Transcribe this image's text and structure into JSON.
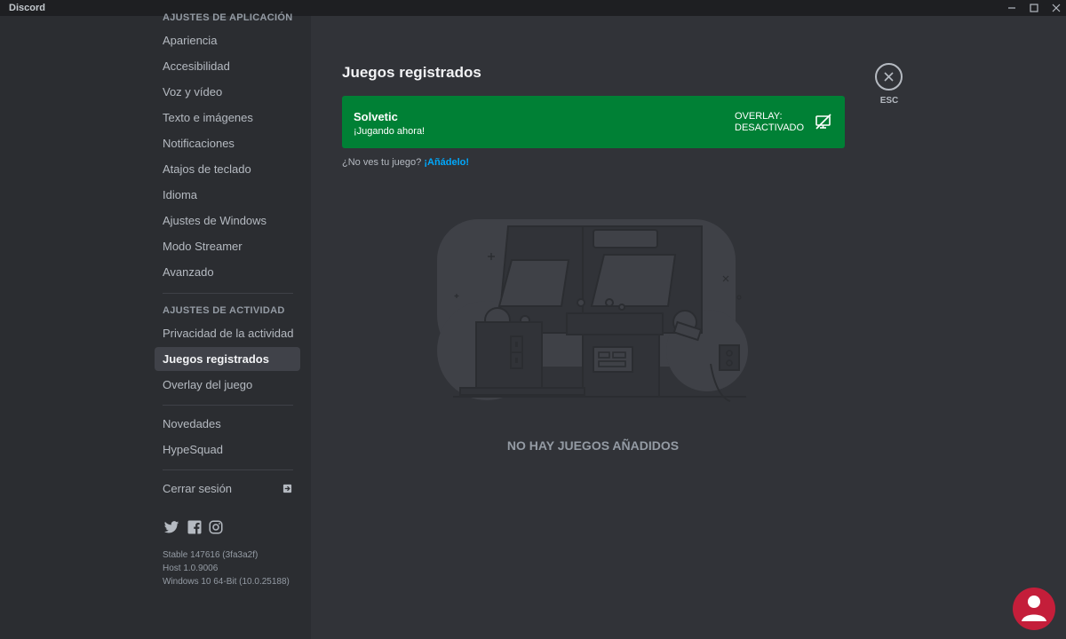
{
  "window": {
    "title": "Discord",
    "minimize": "—",
    "maximize": "☐",
    "close": "✕"
  },
  "sidebar": {
    "section_app": "AJUSTES DE APLICACIÓN",
    "app_items": [
      "Apariencia",
      "Accesibilidad",
      "Voz y vídeo",
      "Texto e imágenes",
      "Notificaciones",
      "Atajos de teclado",
      "Idioma",
      "Ajustes de Windows",
      "Modo Streamer",
      "Avanzado"
    ],
    "section_activity": "AJUSTES DE ACTIVIDAD",
    "activity_items": [
      "Privacidad de la actividad",
      "Juegos registrados",
      "Overlay del juego"
    ],
    "misc_items": [
      "Novedades",
      "HypeSquad"
    ],
    "logout": "Cerrar sesión",
    "socials": [
      "twitter-icon",
      "facebook-icon",
      "instagram-icon"
    ],
    "version_lines": [
      "Stable 147616 (3fa3a2f)",
      "Host 1.0.9006",
      "Windows 10 64-Bit (10.0.25188)"
    ]
  },
  "main": {
    "title": "Juegos registrados",
    "game": {
      "name": "Solvetic",
      "status": "¡Jugando ahora!",
      "overlay_line1": "OVERLAY:",
      "overlay_line2": "DESACTIVADO"
    },
    "hint_text": "¿No ves tu juego?",
    "hint_link": "¡Añádelo!",
    "esc_label": "ESC",
    "empty_state": "NO HAY JUEGOS AÑADIDOS"
  },
  "colors": {
    "accent_green": "#008035",
    "link": "#00a8fc",
    "watermark_red": "#c41e3a"
  }
}
